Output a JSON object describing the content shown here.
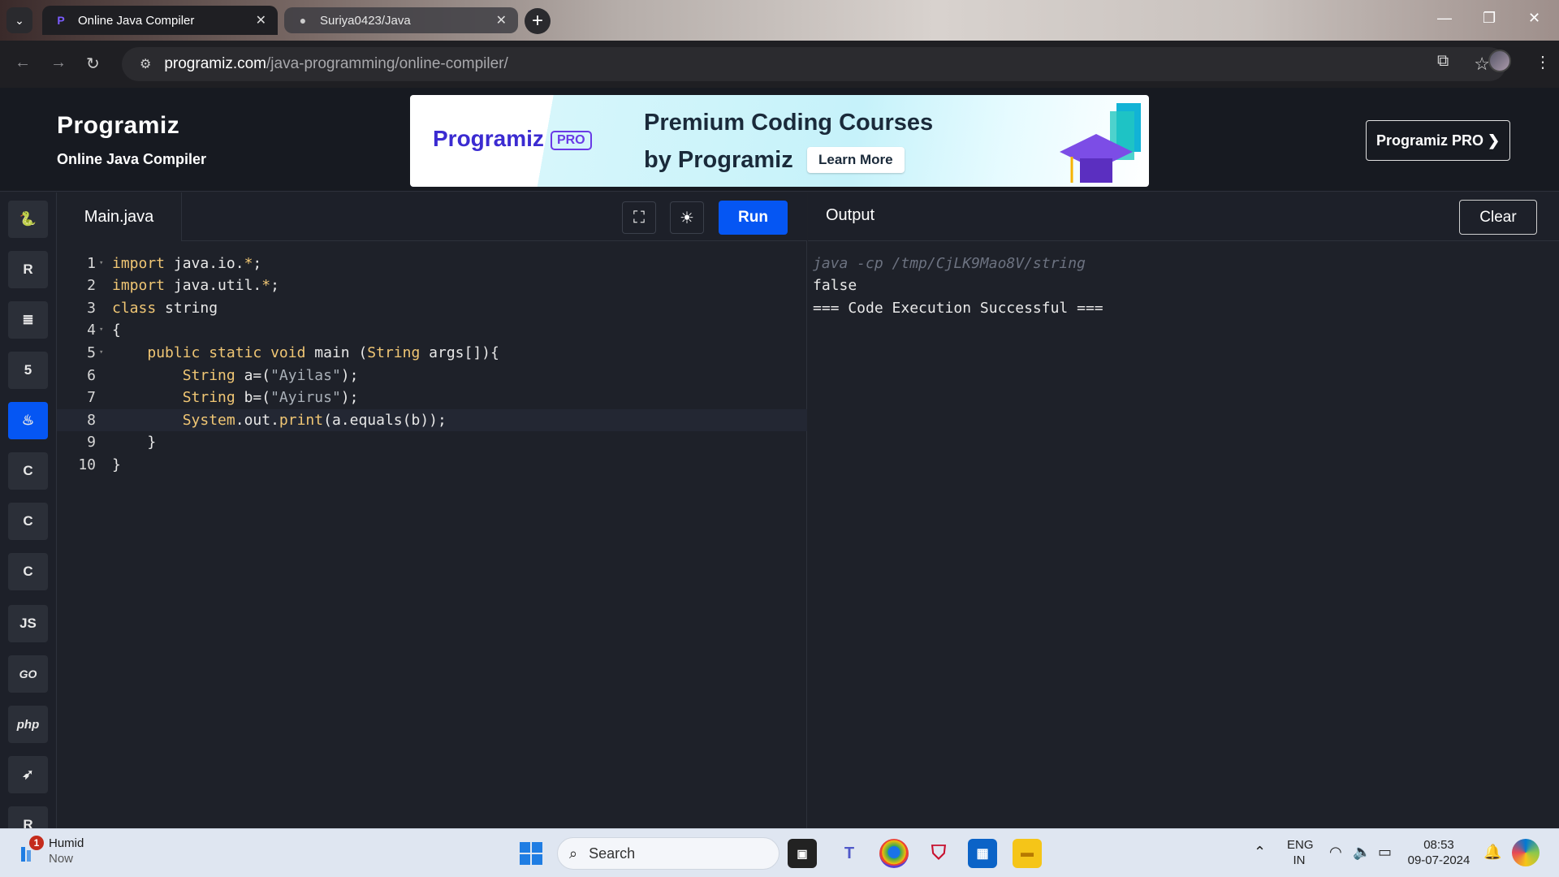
{
  "browser": {
    "tabs": [
      {
        "title": "Online Java Compiler",
        "favicon": "programiz-icon",
        "active": true
      },
      {
        "title": "Suriya0423/Java",
        "favicon": "github-icon",
        "active": false
      }
    ],
    "url_domain": "programiz.com",
    "url_path": "/java-programming/online-compiler/"
  },
  "site": {
    "logo": "Programiz",
    "subtitle": "Online Java Compiler",
    "banner": {
      "logo": "Programiz",
      "badge": "PRO",
      "line1": "Premium Coding Courses",
      "line2": "by Programiz",
      "cta": "Learn More"
    },
    "pro_button": "Programiz PRO ❯"
  },
  "sidebar": {
    "languages": [
      {
        "name": "python",
        "glyph": "🐍",
        "active": false
      },
      {
        "name": "r",
        "glyph": "R",
        "active": false
      },
      {
        "name": "sql",
        "glyph": "≣",
        "active": false
      },
      {
        "name": "html",
        "glyph": "5",
        "active": false
      },
      {
        "name": "java",
        "glyph": "♨",
        "active": true
      },
      {
        "name": "c",
        "glyph": "C",
        "active": false
      },
      {
        "name": "cpp",
        "glyph": "C",
        "active": false
      },
      {
        "name": "csharp",
        "glyph": "C",
        "active": false
      },
      {
        "name": "javascript",
        "glyph": "JS",
        "active": false
      },
      {
        "name": "go",
        "glyph": "GO",
        "active": false
      },
      {
        "name": "php",
        "glyph": "php",
        "active": false
      },
      {
        "name": "swift",
        "glyph": "➶",
        "active": false
      },
      {
        "name": "rust",
        "glyph": "R",
        "active": false
      }
    ]
  },
  "editor": {
    "filename": "Main.java",
    "run_label": "Run",
    "lines": [
      {
        "n": "1",
        "text": "import java.io.*;"
      },
      {
        "n": "2",
        "text": "import java.util.*;"
      },
      {
        "n": "3",
        "text": "class string"
      },
      {
        "n": "4",
        "text": "{"
      },
      {
        "n": "5",
        "text": "    public static void main (String args[]){"
      },
      {
        "n": "6",
        "text": "        String a=(\"Ayilas\");"
      },
      {
        "n": "7",
        "text": "        String b=(\"Ayirus\");"
      },
      {
        "n": "8",
        "text": "        System.out.print(a.equals(b));"
      },
      {
        "n": "9",
        "text": "    }"
      },
      {
        "n": "10",
        "text": "}"
      }
    ]
  },
  "output": {
    "title": "Output",
    "clear_label": "Clear",
    "command": "java -cp /tmp/CjLK9Mao8V/string",
    "lines": [
      "false",
      "=== Code Execution Successful ==="
    ]
  },
  "taskbar": {
    "weather_title": "Humid",
    "weather_sub": "Now",
    "weather_badge": "1",
    "search_placeholder": "Search",
    "lang_top": "ENG",
    "lang_bottom": "IN",
    "time": "08:53",
    "date": "09-07-2024"
  }
}
